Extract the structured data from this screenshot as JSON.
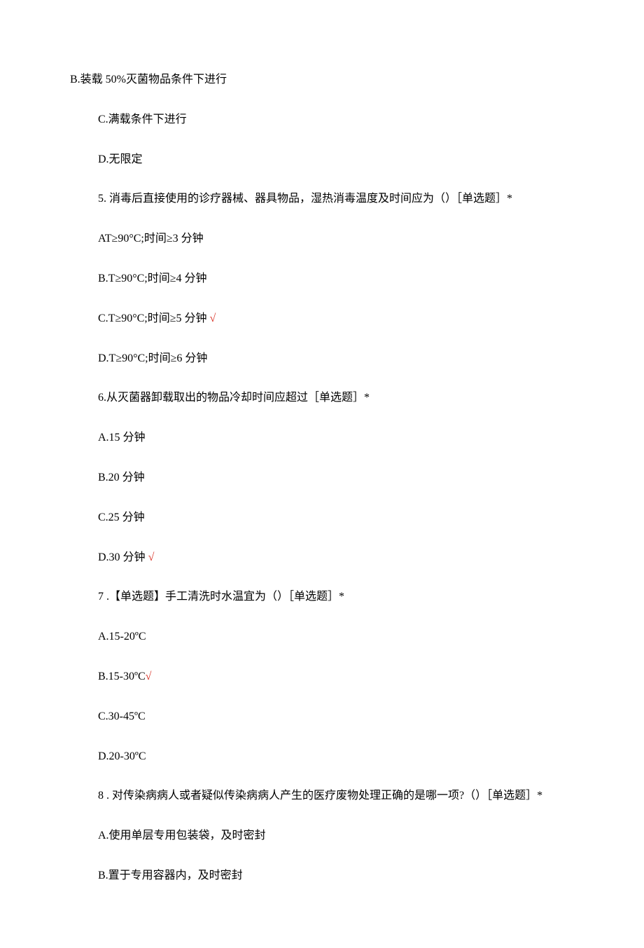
{
  "q4": {
    "optB": "B.装载 50%灭菌物品条件下进行",
    "optC": "C.满载条件下进行",
    "optD": "D.无限定"
  },
  "q5": {
    "stem": "5. 消毒后直接使用的诊疗器械、器具物品，湿热消毒温度及时间应为（）［单选题］*",
    "optA": "AT≥90°C;时间≥3 分钟",
    "optB": "B.T≥90°C;时间≥4 分钟",
    "optC_text": "C.T≥90°C;时间≥5 分钟 ",
    "optC_mark": "√",
    "optD": "D.T≥90°C;时间≥6 分钟"
  },
  "q6": {
    "stem": "6.从灭菌器卸载取出的物品冷却时间应超过［单选题］*",
    "optA": "A.15 分钟",
    "optB": "B.20 分钟",
    "optC": "C.25 分钟",
    "optD_text": "D.30 分钟 ",
    "optD_mark": "√"
  },
  "q7": {
    "stem": "7  .【单选题】手工清洗时水温宜为（）［单选题］*",
    "optA": "A.15-20ºC",
    "optB_text": "B.15-30ºC",
    "optB_mark": "√",
    "optC": "C.30-45ºC",
    "optD": "D.20-30ºC"
  },
  "q8": {
    "stem": "8  . 对传染病病人或者疑似传染病病人产生的医疗废物处理正确的是哪一项?（）［单选题］*",
    "optA": "A.使用单层专用包装袋，及时密封",
    "optB": "B.置于专用容器内，及时密封"
  }
}
